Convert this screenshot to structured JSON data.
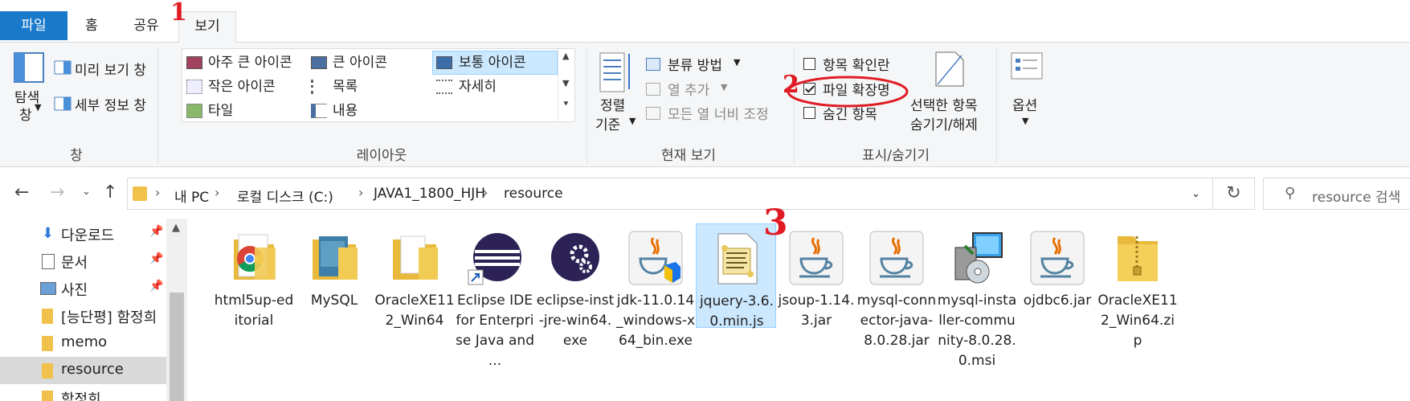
{
  "tabs": {
    "file": "파일",
    "home": "홈",
    "share": "공유",
    "view": "보기"
  },
  "panes": {
    "nav_pane": "탐색",
    "nav_pane2": "창",
    "preview": "미리 보기 창",
    "details": "세부 정보 창",
    "group": "창"
  },
  "layout": {
    "items": [
      "아주 큰 아이콘",
      "큰 아이콘",
      "보통 아이콘",
      "작은 아이콘",
      "목록",
      "자세히",
      "타일",
      "내용"
    ],
    "selected": "보통 아이콘",
    "group": "레이아웃"
  },
  "current_view": {
    "sort1": "정렬",
    "sort2": "기준",
    "group_by": "분류 방법",
    "add_col": "열 추가",
    "size_cols": "모든 열 너비 조정",
    "group": "현재 보기"
  },
  "show_hide": {
    "item_check": "항목 확인란",
    "extensions": "파일 확장명",
    "hidden": "숨긴 항목",
    "hide_sel1": "선택한 항목",
    "hide_sel2": "숨기기/해제",
    "group": "표시/숨기기",
    "extensions_checked": true
  },
  "options": {
    "label": "옵션"
  },
  "address": {
    "crumbs": [
      "내 PC",
      "로컬 디스크 (C:)",
      "JAVA1_1800_HJH",
      "resource"
    ],
    "search_placeholder": "resource 검색"
  },
  "sidebar": {
    "items": [
      {
        "label": "다운로드",
        "pinned": true
      },
      {
        "label": "문서",
        "pinned": true
      },
      {
        "label": "사진",
        "pinned": true
      },
      {
        "label": "[능단평] 함정희",
        "pinned": false
      },
      {
        "label": "memo",
        "pinned": false
      },
      {
        "label": "resource",
        "pinned": false
      },
      {
        "label": "함정희",
        "pinned": false
      }
    ],
    "selected": "resource"
  },
  "files": [
    {
      "name": "html5up-editorial",
      "icon": "chrome-folder-icon"
    },
    {
      "name": "MySQL",
      "icon": "folder-icon"
    },
    {
      "name": "OracleXE112_Win64",
      "icon": "folder-icon"
    },
    {
      "name": "Eclipse IDE for Enterprise Java and ...",
      "icon": "eclipse-shortcut-icon"
    },
    {
      "name": "eclipse-inst-jre-win64.exe",
      "icon": "eclipse-installer-icon"
    },
    {
      "name": "jdk-11.0.14_windows-x64_bin.exe",
      "icon": "java-installer-icon"
    },
    {
      "name": "jquery-3.6.0.min.js",
      "icon": "js-script-icon"
    },
    {
      "name": "jsoup-1.14.3.jar",
      "icon": "java-jar-icon"
    },
    {
      "name": "mysql-connector-java-8.0.28.jar",
      "icon": "java-jar-icon"
    },
    {
      "name": "mysql-installer-community-8.0.28.0.msi",
      "icon": "msi-installer-icon"
    },
    {
      "name": "ojdbc6.jar",
      "icon": "java-jar-icon"
    },
    {
      "name": "OracleXE112_Win64.zip",
      "icon": "zip-folder-icon"
    }
  ],
  "selected_file": "jquery-3.6.0.min.js",
  "annotations": [
    "1",
    "2",
    "3"
  ],
  "colors": {
    "accent": "#1979ca",
    "selection": "#cce8ff",
    "annotation": "#e01b24"
  }
}
